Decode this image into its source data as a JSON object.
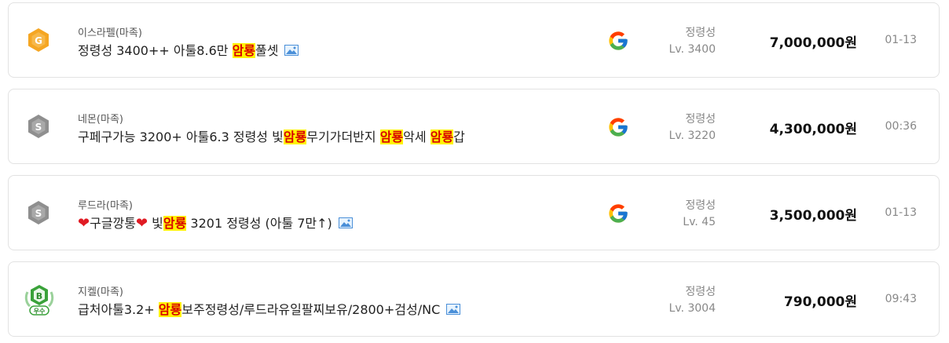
{
  "listings": [
    {
      "server": "이스라펠(마족)",
      "title_parts": [
        "정령성 3400++ 아툴8.6만 ",
        "암룡",
        "풀셋"
      ],
      "has_image_icon": true,
      "badge": "G",
      "platform_icon": "google-icon",
      "class": "정령성",
      "level": "Lv. 3400",
      "price": "7,000,000원",
      "time": "01-13"
    },
    {
      "server": "네몬(마족)",
      "title_parts": [
        "구페구가능 3200+ 아툴6.3 정령성 빛",
        "암룡",
        "무기가더반지 ",
        "암룡",
        "악세 ",
        "암룡",
        "갑"
      ],
      "has_image_icon": false,
      "badge": "S",
      "platform_icon": "google-icon",
      "class": "정령성",
      "level": "Lv. 3220",
      "price": "4,300,000원",
      "time": "00:36"
    },
    {
      "server": "루드라(마족)",
      "title_parts": [
        "구글깡통",
        " 빛",
        "암룡",
        " 3201 정령성 (아툴 7만↑)"
      ],
      "has_image_icon": true,
      "badge": "S",
      "platform_icon": "google-icon",
      "class": "정령성",
      "level": "Lv. 45",
      "price": "3,500,000원",
      "time": "01-13"
    },
    {
      "server": "지켈(마족)",
      "title_parts": [
        "급처아툴3.2+ ",
        "암룡",
        "보주정령성/루드라유일팔찌보유/2800+검성/NC"
      ],
      "has_image_icon": true,
      "badge": "B",
      "badge_sub": "우수",
      "platform_icon": "",
      "class": "정령성",
      "level": "Lv. 3004",
      "price": "790,000원",
      "time": "09:43"
    }
  ],
  "colors": {
    "highlight_bg": "#fff200",
    "highlight_text": "#d80000",
    "gold_badge": "#f5a623",
    "silver_badge": "#8f8f8f",
    "green_badge": "#3aa23a"
  },
  "heart": "❤"
}
